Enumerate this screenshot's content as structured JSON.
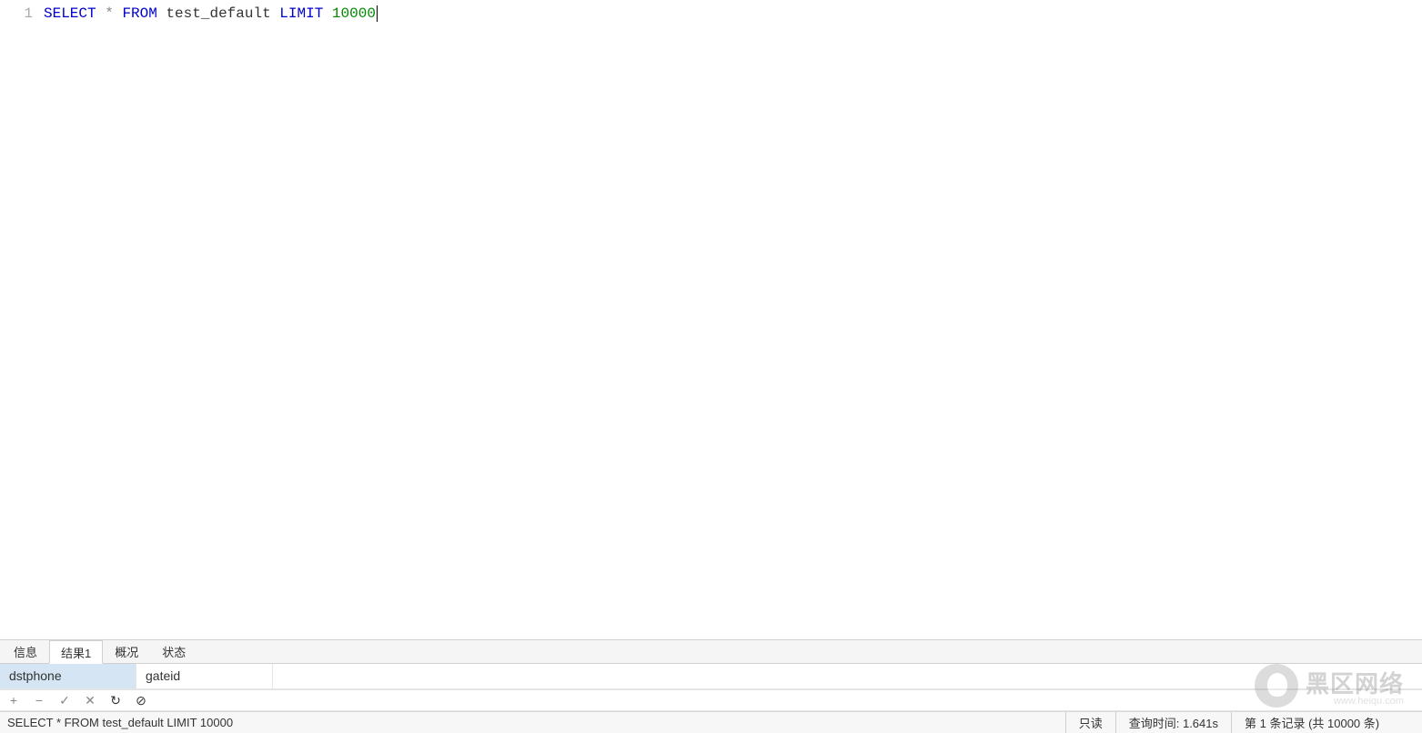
{
  "editor": {
    "line_number": "1",
    "sql": {
      "kw_select": "SELECT",
      "star": "*",
      "kw_from": "FROM",
      "table": "test_default",
      "kw_limit": "LIMIT",
      "limit_val": "10000"
    }
  },
  "tabs": {
    "info": "信息",
    "result1": "结果1",
    "profile": "概况",
    "status": "状态"
  },
  "result_columns": {
    "col1": "dstphone",
    "col2": "gateid"
  },
  "toolbar_icons": {
    "add": "+",
    "remove": "−",
    "apply": "✓",
    "cancel": "✕",
    "refresh": "↻",
    "stop": "⊘"
  },
  "statusbar": {
    "query": "SELECT * FROM test_default LIMIT 10000",
    "readonly": "只读",
    "query_time": "查询时间: 1.641s",
    "record_info": "第 1 条记录 (共 10000 条)"
  },
  "watermark": {
    "title": "黑区网络",
    "sub": "www.heiqu.com"
  }
}
